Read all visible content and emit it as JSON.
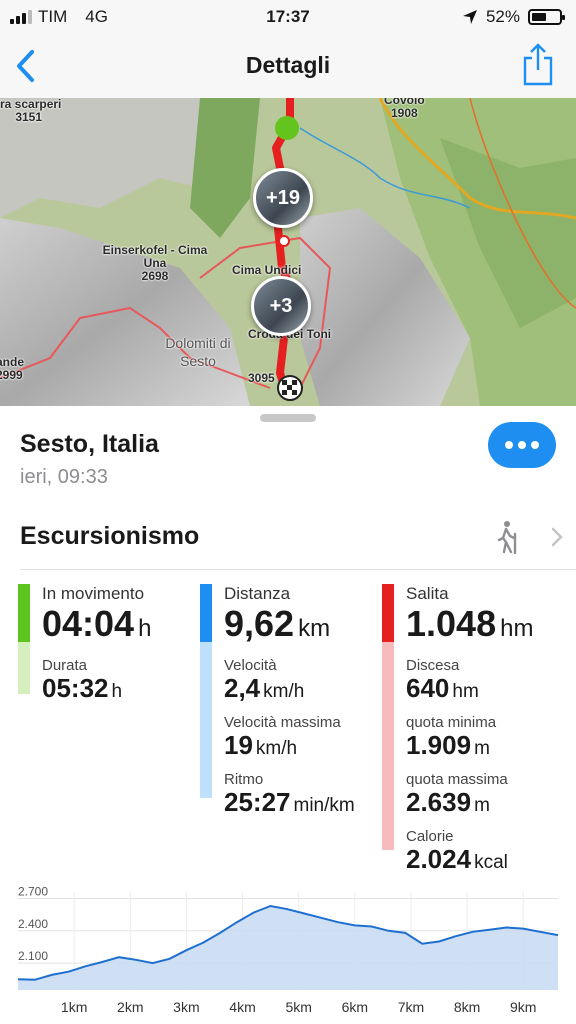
{
  "status": {
    "carrier": "TIM",
    "network": "4G",
    "time": "17:37",
    "battery": "52%",
    "battery_level": 0.52
  },
  "nav": {
    "title": "Dettagli",
    "back_icon": "chevron-left-icon",
    "share_icon": "share-icon",
    "accent": "#1e8ef0"
  },
  "map": {
    "labels": {
      "scarperi": "tra scarperi",
      "scarperi_alt": "3151",
      "covolo": "Covolo",
      "covolo_alt": "1908",
      "einserkofel": "Einserkofel - Cima",
      "una": "Una",
      "una_alt": "2698",
      "cima_undici": "Cima Undici",
      "dolomiti": "Dolomiti di",
      "sesto_region": "Sesto",
      "croda": "Croda dei Toni",
      "croda_alt": "3095",
      "ande": "ande",
      "ande_alt": "2999"
    },
    "photo_badges": [
      "+19",
      "+3"
    ]
  },
  "activity": {
    "place": "Sesto, Italia",
    "datetime": "ieri, 09:33",
    "type": "Escursionismo"
  },
  "stats": {
    "moving": {
      "label": "In movimento",
      "value": "04:04",
      "unit": "h",
      "color": "#5fc31f",
      "light": "#d5efbe"
    },
    "duration": {
      "label": "Durata",
      "value": "05:32",
      "unit": "h"
    },
    "distance": {
      "label": "Distanza",
      "value": "9,62",
      "unit": "km",
      "color": "#1e8ef0",
      "light": "#bfe0fb"
    },
    "speed": {
      "label": "Velocità",
      "value": "2,4",
      "unit": "km/h"
    },
    "max_speed": {
      "label": "Velocità massima",
      "value": "19",
      "unit": "km/h"
    },
    "pace": {
      "label": "Ritmo",
      "value": "25:27",
      "unit": "min/km"
    },
    "ascent": {
      "label": "Salita",
      "value": "1.048",
      "unit": "hm",
      "color": "#e62020",
      "light": "#f6bcbc"
    },
    "descent": {
      "label": "Discesa",
      "value": "640",
      "unit": "hm"
    },
    "min_alt": {
      "label": "quota minima",
      "value": "1.909",
      "unit": "m"
    },
    "max_alt": {
      "label": "quota massima",
      "value": "2.639",
      "unit": "m"
    },
    "calories": {
      "label": "Calorie",
      "value": "2.024",
      "unit": "kcal"
    }
  },
  "chart_data": {
    "type": "area",
    "x": [
      0,
      0.3,
      0.6,
      0.9,
      1.2,
      1.5,
      1.8,
      2.1,
      2.4,
      2.7,
      3.0,
      3.3,
      3.6,
      3.9,
      4.2,
      4.5,
      4.8,
      5.1,
      5.4,
      5.7,
      6.0,
      6.3,
      6.6,
      6.9,
      7.2,
      7.5,
      7.8,
      8.1,
      8.4,
      8.7,
      9.0,
      9.3,
      9.62
    ],
    "values": [
      1950,
      1945,
      1990,
      2020,
      2070,
      2110,
      2155,
      2130,
      2100,
      2140,
      2220,
      2290,
      2380,
      2480,
      2570,
      2630,
      2600,
      2560,
      2520,
      2480,
      2450,
      2440,
      2400,
      2380,
      2280,
      2300,
      2350,
      2390,
      2410,
      2430,
      2420,
      2390,
      2360
    ],
    "yticks": [
      "2.700",
      "2.400",
      "2.100"
    ],
    "ytick_values": [
      2700,
      2400,
      2100
    ],
    "xticks": [
      "1km",
      "2km",
      "3km",
      "4km",
      "5km",
      "6km",
      "7km",
      "8km",
      "9km"
    ],
    "xtick_values": [
      1,
      2,
      3,
      4,
      5,
      6,
      7,
      8,
      9
    ],
    "xlim": [
      0,
      9.62
    ],
    "ylim": [
      1850,
      2760
    ],
    "grid": true,
    "line_color": "#1e6fd0",
    "fill_color": "#c7daf3"
  }
}
